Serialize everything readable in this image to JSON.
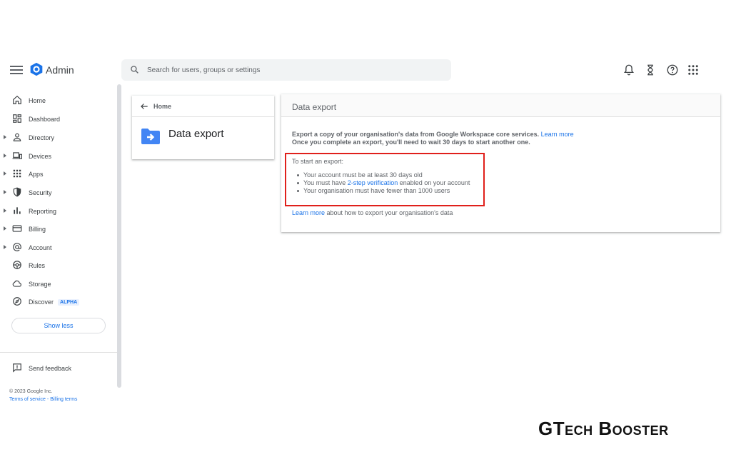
{
  "topbar": {
    "app_name": "Admin",
    "search_placeholder": "Search for users, groups or settings"
  },
  "sidebar": {
    "items": [
      {
        "label": "Home",
        "icon": "home-icon",
        "expandable": false
      },
      {
        "label": "Dashboard",
        "icon": "dashboard-icon",
        "expandable": false
      },
      {
        "label": "Directory",
        "icon": "person-icon",
        "expandable": true
      },
      {
        "label": "Devices",
        "icon": "devices-icon",
        "expandable": true
      },
      {
        "label": "Apps",
        "icon": "apps-grid-icon",
        "expandable": true
      },
      {
        "label": "Security",
        "icon": "shield-icon",
        "expandable": true
      },
      {
        "label": "Reporting",
        "icon": "bar-chart-icon",
        "expandable": true
      },
      {
        "label": "Billing",
        "icon": "credit-card-icon",
        "expandable": true
      },
      {
        "label": "Account",
        "icon": "at-sign-icon",
        "expandable": true
      },
      {
        "label": "Rules",
        "icon": "rules-icon",
        "expandable": false
      },
      {
        "label": "Storage",
        "icon": "cloud-icon",
        "expandable": false
      },
      {
        "label": "Discover",
        "icon": "compass-icon",
        "expandable": false,
        "badge": "ALPHA"
      }
    ],
    "show_less": "Show less",
    "send_feedback": "Send feedback",
    "copyright": "© 2023 Google Inc.",
    "terms": "Terms of service",
    "separator": " - ",
    "billing_terms": "Billing terms"
  },
  "home_card": {
    "breadcrumb": "Home",
    "title": "Data export"
  },
  "main_card": {
    "header": "Data export",
    "description_line1": "Export a copy of your organisation's data from Google Workspace core services.",
    "description_link": "Learn more",
    "description_line2": "Once you complete an export, you'll need to wait 30 days to start another one.",
    "requirements_title": "To start an export:",
    "requirement_1": "Your account must be at least 30 days old",
    "requirement_2_pre": "You must have ",
    "requirement_2_link": "2-step verification",
    "requirement_2_post": " enabled on your account",
    "requirement_3": "Your organisation must have fewer than 1000 users",
    "learn_more_link": "Learn more",
    "learn_more_text": " about how to export your organisation's data"
  },
  "watermark": "GTech Booster",
  "colors": {
    "accent": "#1a73e8",
    "highlight_border": "#e0201b",
    "text_secondary": "#5f6368"
  }
}
